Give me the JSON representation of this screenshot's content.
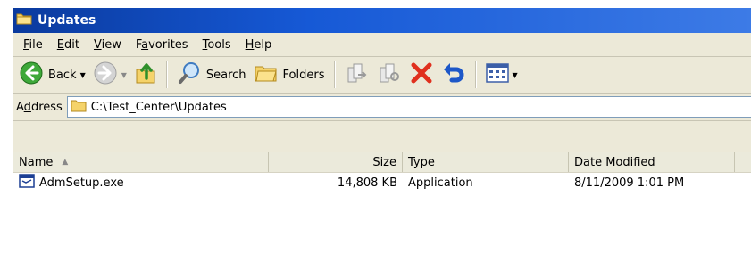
{
  "window": {
    "title": "Updates",
    "title_icon": "folder-icon"
  },
  "menu": [
    {
      "pre": "",
      "acc": "F",
      "post": "ile"
    },
    {
      "pre": "",
      "acc": "E",
      "post": "dit"
    },
    {
      "pre": "",
      "acc": "V",
      "post": "iew"
    },
    {
      "pre": "F",
      "acc": "a",
      "post": "vorites"
    },
    {
      "pre": "",
      "acc": "T",
      "post": "ools"
    },
    {
      "pre": "",
      "acc": "H",
      "post": "elp"
    }
  ],
  "toolbar": {
    "back": "Back",
    "search": "Search",
    "folders": "Folders"
  },
  "address": {
    "label_pre": "A",
    "label_acc": "d",
    "label_post": "dress",
    "value": "C:\\Test_Center\\Updates"
  },
  "list": {
    "columns": [
      "Name",
      "Size",
      "Type",
      "Date Modified"
    ],
    "rows": [
      {
        "name": "AdmSetup.exe",
        "size": "14,808 KB",
        "type": "Application",
        "date": "8/11/2009 1:01 PM"
      }
    ]
  },
  "colors": {
    "title_gradient_start": "#0a3a9e",
    "title_gradient_end": "#3d7be6",
    "chrome": "#ece9d8"
  }
}
